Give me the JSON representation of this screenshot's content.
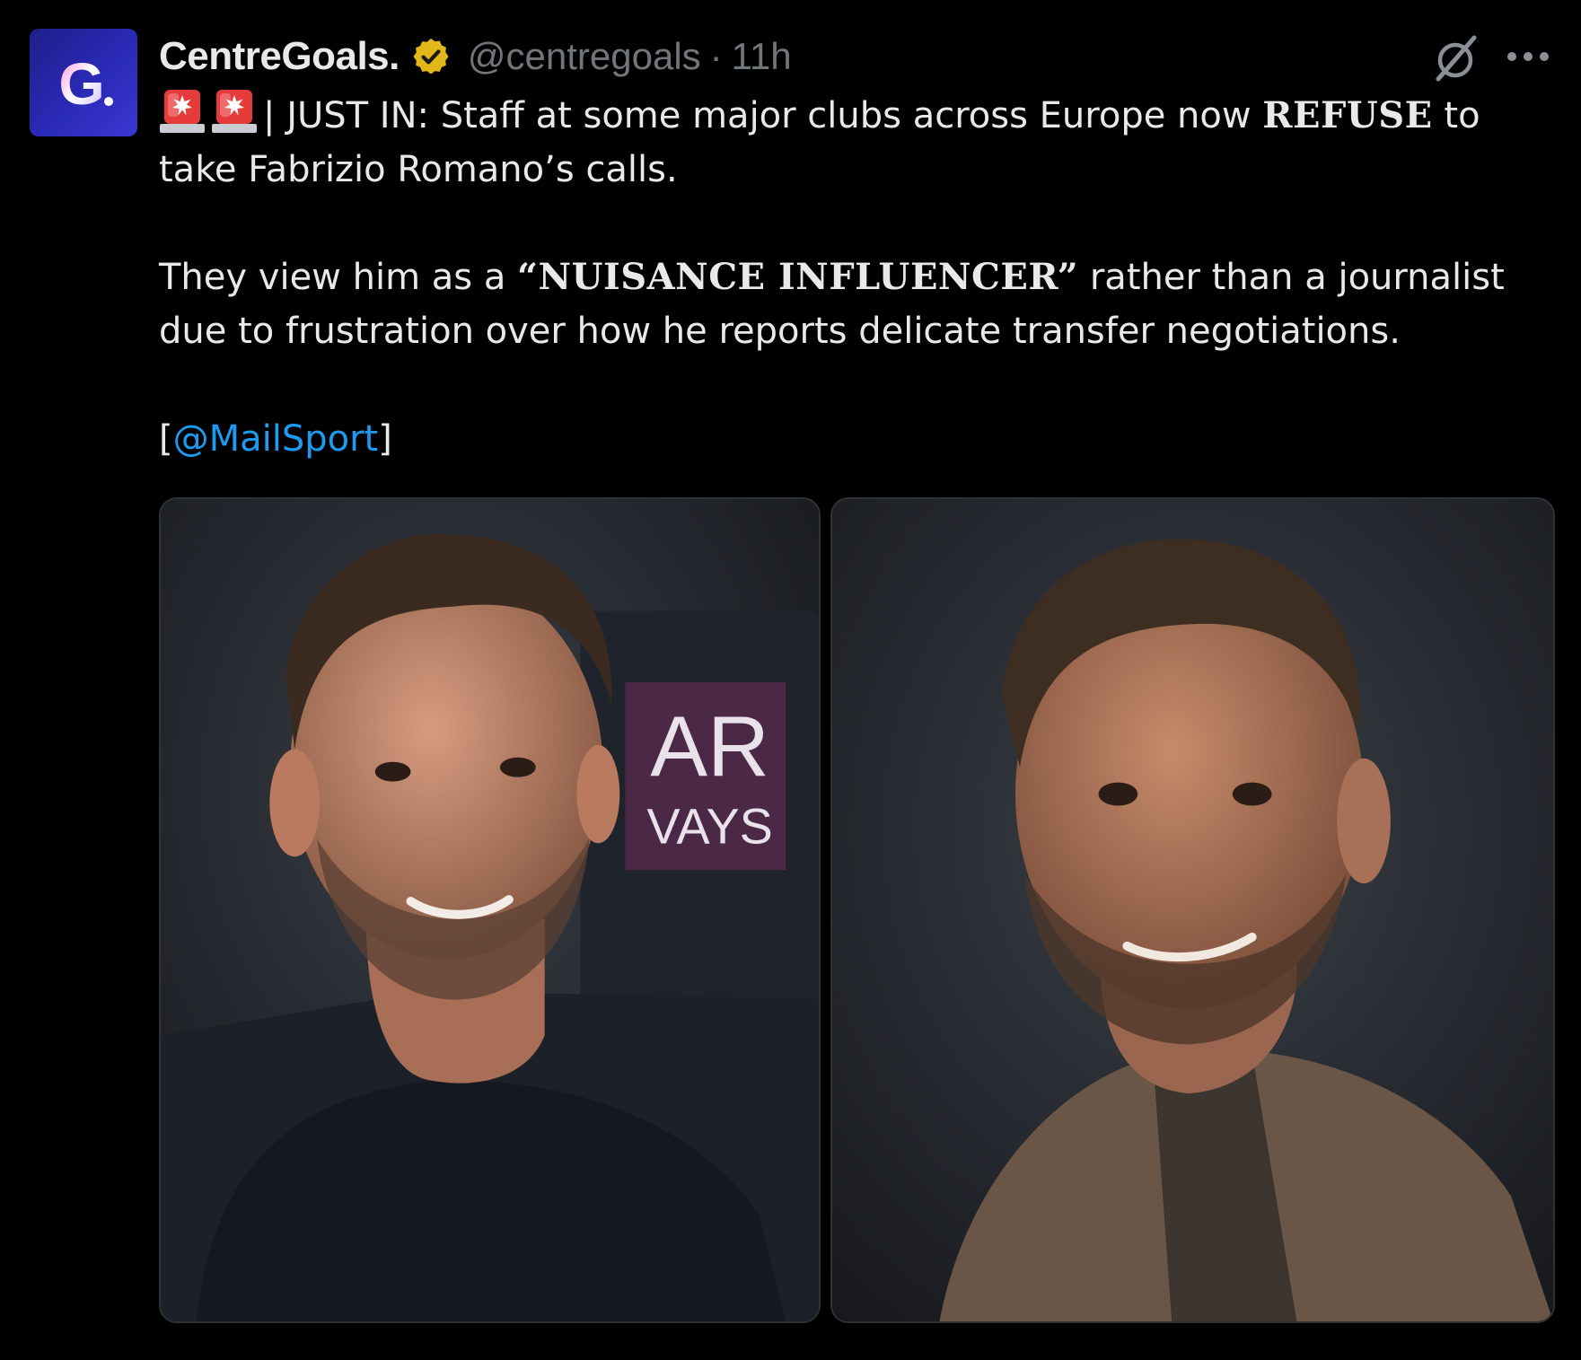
{
  "post": {
    "author": {
      "display_name": "CentreGoals.",
      "handle": "@centregoals",
      "avatar_letter": "G",
      "verified_badge": "gold-verified-icon"
    },
    "separator": "·",
    "timestamp": "11h",
    "actions": {
      "grok": "grok-icon",
      "more": "more-options-icon"
    },
    "text": {
      "p1_prefix": "| JUST IN: Staff at some major clubs across Europe now ",
      "p1_emphasis": "REFUSE",
      "p1_suffix": " to take Fabrizio Romano’s calls.",
      "p2_prefix": "They view him as a ",
      "p2_emphasis": "“NUISANCE INFLUENCER”",
      "p2_suffix": " rather than a journalist due to frustration over how he reports delicate transfer negotiations.",
      "p3_open": "[",
      "p3_mention": "@MailSport",
      "p3_close": "]"
    },
    "emoji": [
      "siren-icon",
      "siren-icon"
    ],
    "media": [
      {
        "name": "photo-man-dark-shirt",
        "background_sign": {
          "line1": "AR",
          "line2": "VAYS"
        }
      },
      {
        "name": "photo-man-brown-jacket"
      }
    ]
  },
  "colors": {
    "background": "#000000",
    "text": "#e7e9ea",
    "secondary": "#71767b",
    "link": "#1d9bf0",
    "verified_gold": "#e2b719",
    "avatar_blue": "#2a2ab8"
  }
}
